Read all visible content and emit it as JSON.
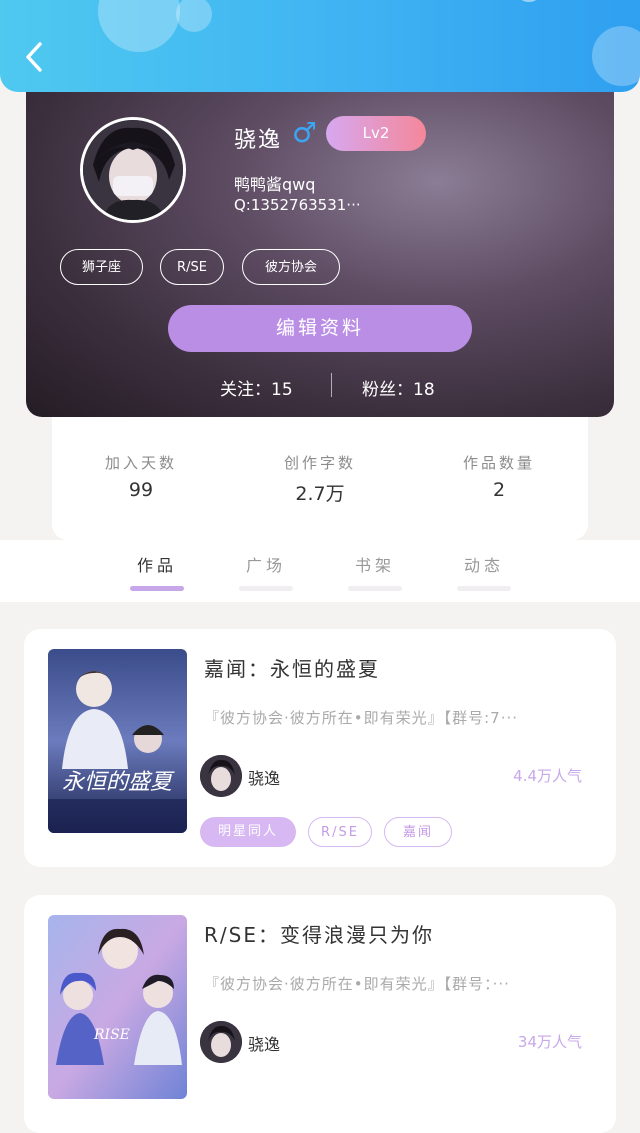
{
  "profile": {
    "username": "骁逸",
    "gender_symbol": "♂",
    "level": "Lv2",
    "nickname": "鸭鸭酱qwq",
    "qq": "Q:1352763531···",
    "tags": [
      "狮子座",
      "R/SE",
      "彼方协会"
    ],
    "edit_button": "编辑资料",
    "following": "关注：15",
    "fans": "粉丝：18"
  },
  "stats": [
    {
      "label": "加入天数",
      "value": "99"
    },
    {
      "label": "创作字数",
      "value": "2.7万"
    },
    {
      "label": "作品数量",
      "value": "2"
    }
  ],
  "tabs": [
    {
      "label": "作品",
      "active": true
    },
    {
      "label": "广场",
      "active": false
    },
    {
      "label": "书架",
      "active": false
    },
    {
      "label": "动态",
      "active": false
    }
  ],
  "works": [
    {
      "title": "嘉闻：永恒的盛夏",
      "desc": "『彼方协会·彼方所在•即有荣光』【群号:7···",
      "author": "骁逸",
      "popularity": "4.4万人气",
      "tags": [
        "明星同人",
        "R/SE",
        "嘉闻"
      ],
      "cover_text": "永恒的盛夏"
    },
    {
      "title": "R/SE：变得浪漫只为你",
      "desc": "『彼方协会·彼方所在•即有荣光』【群号：···",
      "author": "骁逸",
      "popularity": "34万人气",
      "cover_text": "RISE"
    }
  ],
  "icons": {
    "back": "back-arrow-icon"
  },
  "colors": {
    "accent": "#bb8ee6",
    "topbar": "#3fb3f2",
    "male": "#3ba6f5"
  }
}
